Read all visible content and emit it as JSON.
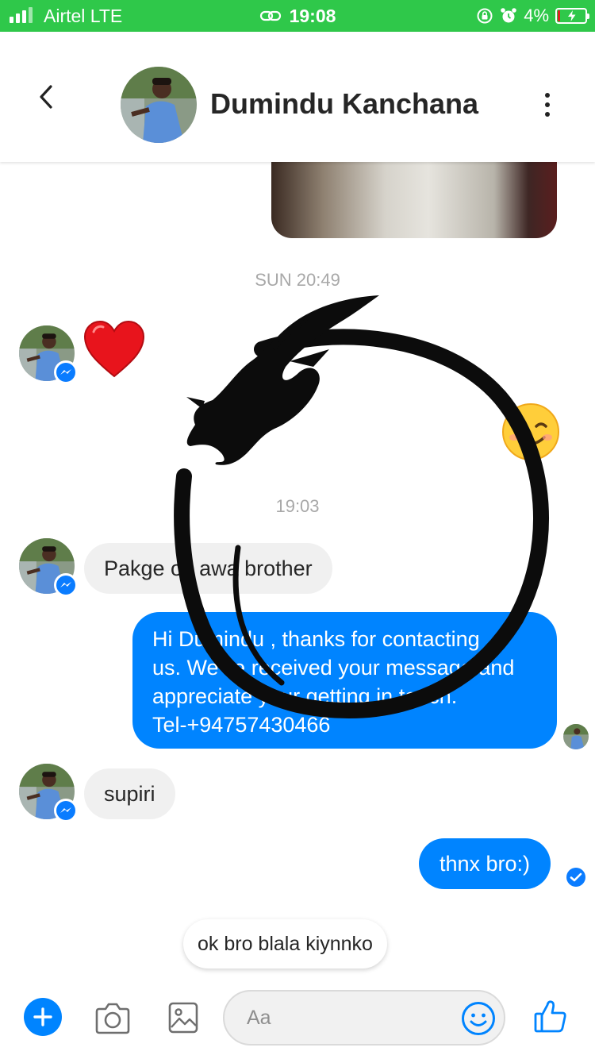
{
  "status_bar": {
    "carrier": "Airtel  LTE",
    "time": "19:08",
    "battery": "4%",
    "battery_level_percent": 4,
    "signal_bars": 4
  },
  "header": {
    "contact_name": "Dumindu Kanchana"
  },
  "messages": {
    "timestamp_1": "SUN 20:49",
    "timestamp_2": "19:03",
    "incoming_1": "Pakge ok awa brother",
    "outgoing_1": {
      "line1": "Hi Dumindu , thanks for contacting",
      "line2": "us. We've received your message and",
      "line3": "appreciate your getting in touch.",
      "line4": "Tel-+94757430466"
    },
    "incoming_2": "supiri",
    "outgoing_2": "thnx bro:)",
    "typing_preview": "ok bro blala kiynnko"
  },
  "composer": {
    "placeholder": "Aa"
  },
  "colors": {
    "status_green": "#2fc84a",
    "messenger_blue": "#0084ff",
    "incoming_bubble": "#f0f0f0"
  },
  "icons": [
    "back-icon",
    "more-icon",
    "messenger-icon",
    "heart-emoji",
    "smiley-emoji",
    "plus-icon",
    "camera-icon",
    "gallery-icon",
    "emoji-icon",
    "like-icon",
    "dragon-sticker"
  ]
}
